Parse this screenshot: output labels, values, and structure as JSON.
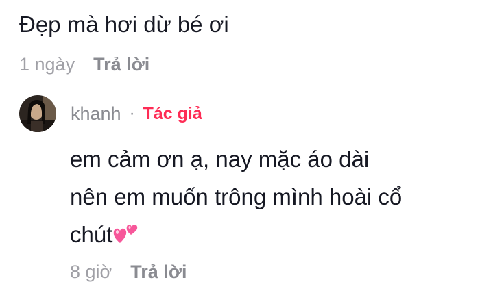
{
  "comment": {
    "text": "Đẹp mà hơi dừ bé ơi",
    "time": "1 ngày",
    "reply_label": "Trả lời"
  },
  "reply": {
    "username": "khanh",
    "separator": "·",
    "author_badge": "Tác giả",
    "lines": [
      "em cảm ơn ạ, nay mặc áo dài",
      "nên em muốn trông mình hoài cổ",
      "chút"
    ],
    "emoji": "two-hearts-icon",
    "time": "8 giờ",
    "reply_label": "Trả lời"
  },
  "colors": {
    "text": "#161823",
    "meta": "#a0a0a6",
    "author_badge": "#fe2c55",
    "emoji": "#f7579a"
  }
}
